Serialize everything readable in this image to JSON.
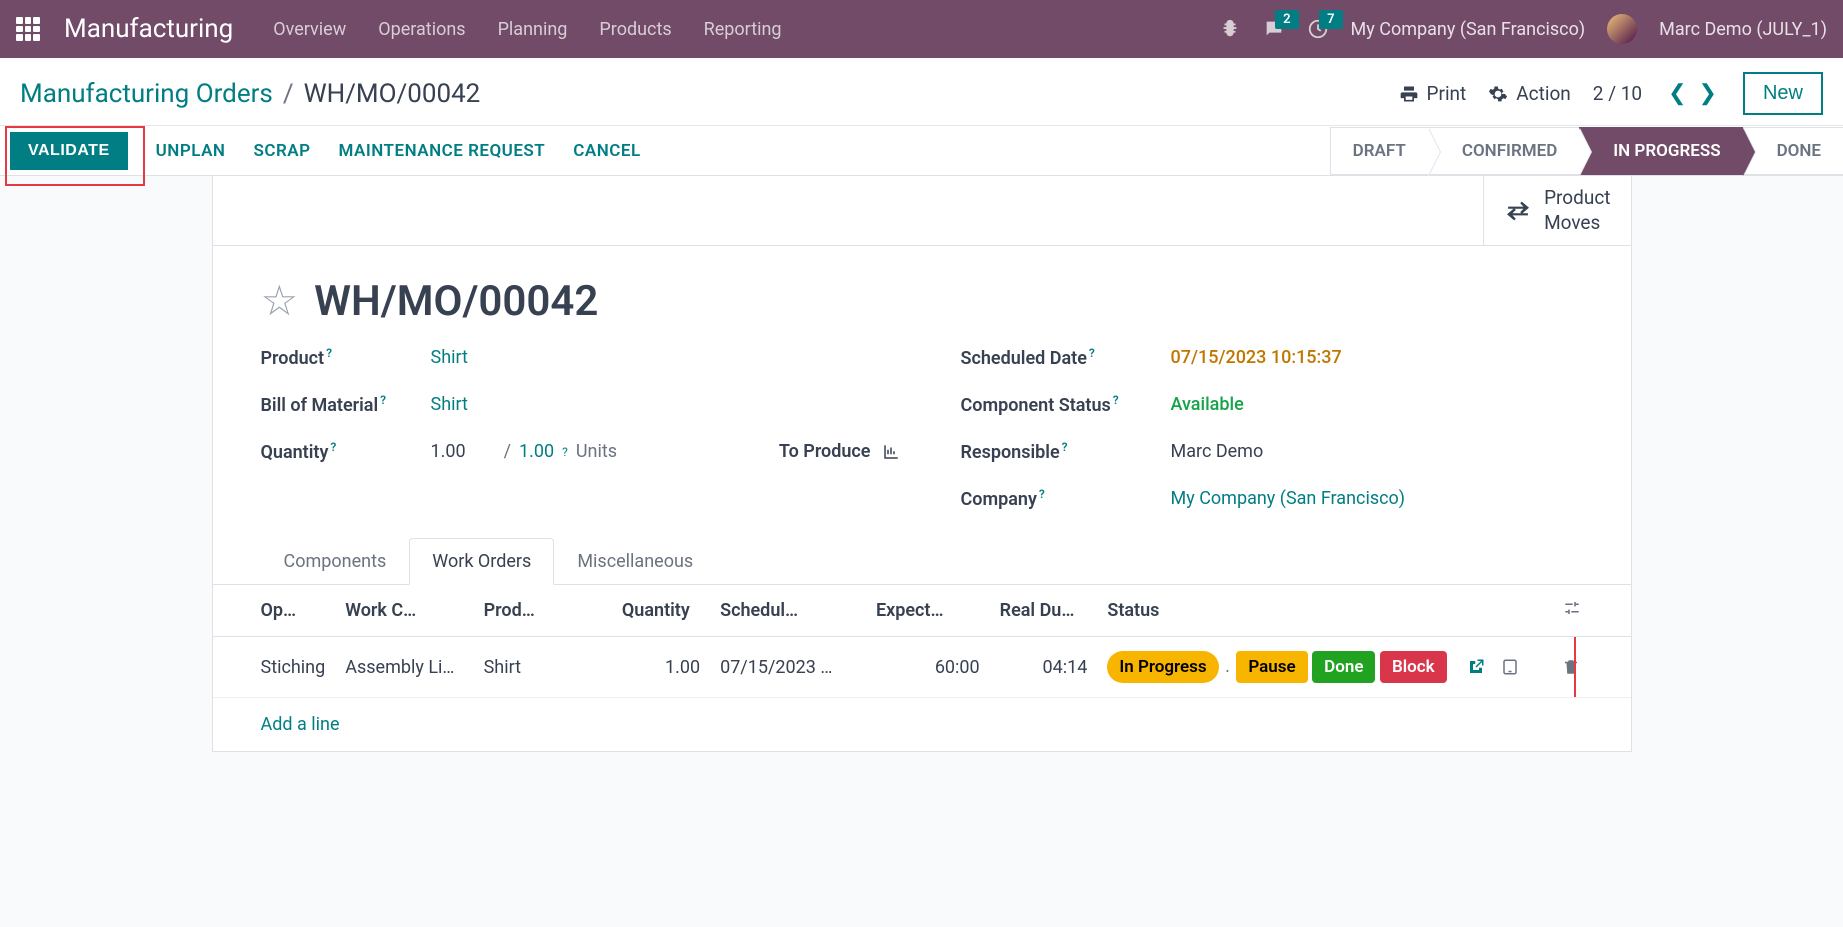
{
  "nav": {
    "brand": "Manufacturing",
    "menu": [
      "Overview",
      "Operations",
      "Planning",
      "Products",
      "Reporting"
    ],
    "msg_badge": "2",
    "activity_badge": "7",
    "company": "My Company (San Francisco)",
    "user": "Marc Demo (JULY_1)"
  },
  "breadcrumb": {
    "root": "Manufacturing Orders",
    "current": "WH/MO/00042",
    "print": "Print",
    "action": "Action",
    "pager": "2 / 10",
    "new": "New"
  },
  "actions": {
    "validate": "VALIDATE",
    "unplan": "UNPLAN",
    "scrap": "SCRAP",
    "maintenance": "MAINTENANCE REQUEST",
    "cancel": "CANCEL"
  },
  "status_steps": [
    "DRAFT",
    "CONFIRMED",
    "IN PROGRESS",
    "DONE"
  ],
  "stat_button": "Product\nMoves",
  "title": "WH/MO/00042",
  "fields": {
    "product_label": "Product",
    "product_value": "Shirt",
    "bom_label": "Bill of Material",
    "bom_value": "Shirt",
    "qty_label": "Quantity",
    "qty_value": "1.00",
    "qty_done": "1.00",
    "qty_sep": "/",
    "qty_unit": "Units",
    "qty_help": "?",
    "to_produce": "To Produce",
    "sched_label": "Scheduled Date",
    "sched_value": "07/15/2023 10:15:37",
    "comp_status_label": "Component Status",
    "comp_status_value": "Available",
    "resp_label": "Responsible",
    "resp_value": "Marc Demo",
    "company_label": "Company",
    "company_value": "My Company (San Francisco)"
  },
  "tabs": {
    "components": "Components",
    "work_orders": "Work Orders",
    "misc": "Miscellaneous"
  },
  "table": {
    "headers": {
      "op": "Op…",
      "wc": "Work C…",
      "prod": "Prod…",
      "qty": "Quantity",
      "sched": "Schedul…",
      "expect": "Expect…",
      "real": "Real Du…",
      "status": "Status"
    },
    "row": {
      "op": "Stiching",
      "wc": "Assembly Li…",
      "prod": "Shirt",
      "qty": "1.00",
      "sched": "07/15/2023 …",
      "expect": "60:00",
      "real": "04:14",
      "status": "In Progress",
      "pause": "Pause",
      "done": "Done",
      "block": "Block"
    },
    "add_line": "Add a line"
  }
}
